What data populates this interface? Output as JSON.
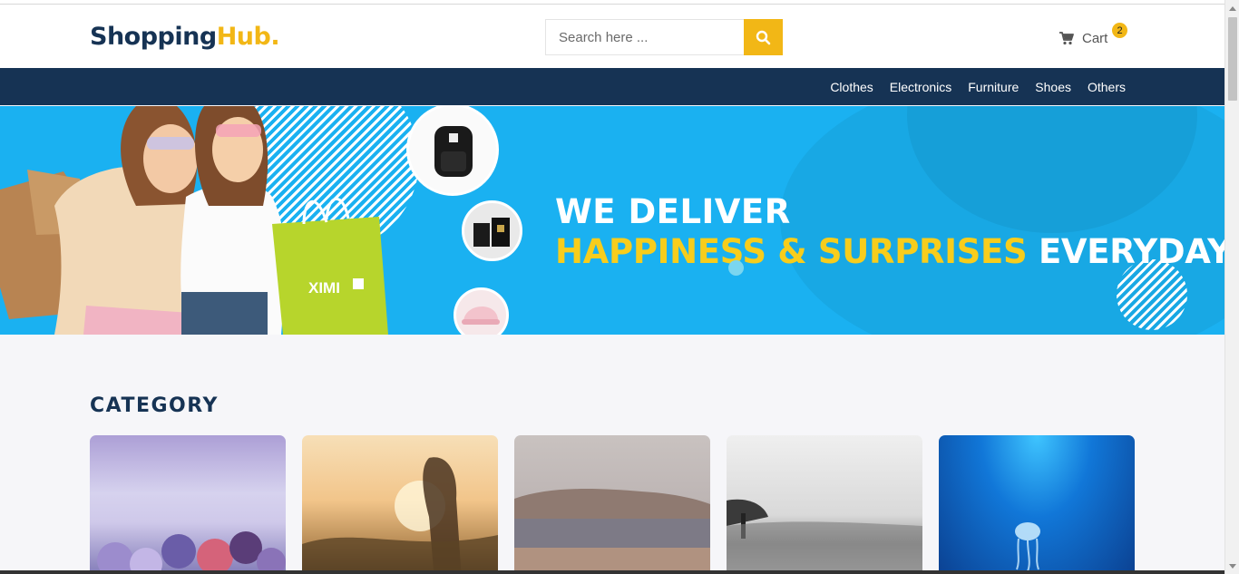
{
  "header": {
    "logo_primary": "Shopping",
    "logo_accent": "Hub.",
    "search_placeholder": "Search here ...",
    "cart_label": "Cart",
    "cart_count": "2"
  },
  "nav": {
    "items": [
      "Clothes",
      "Electronics",
      "Furniture",
      "Shoes",
      "Others"
    ]
  },
  "hero": {
    "line1": "WE DELIVER",
    "line2_highlight": "HAPPINESS & SURPRISES",
    "line2_rest": "EVERYDAY",
    "bag_text": "XIMI"
  },
  "main": {
    "category_title": "CATEGORY"
  },
  "colors": {
    "brand_navy": "#163354",
    "accent_yellow": "#f2b716",
    "hero_blue": "#1ab1f1"
  },
  "icons": {
    "search": "search-icon",
    "cart": "cart-icon"
  }
}
